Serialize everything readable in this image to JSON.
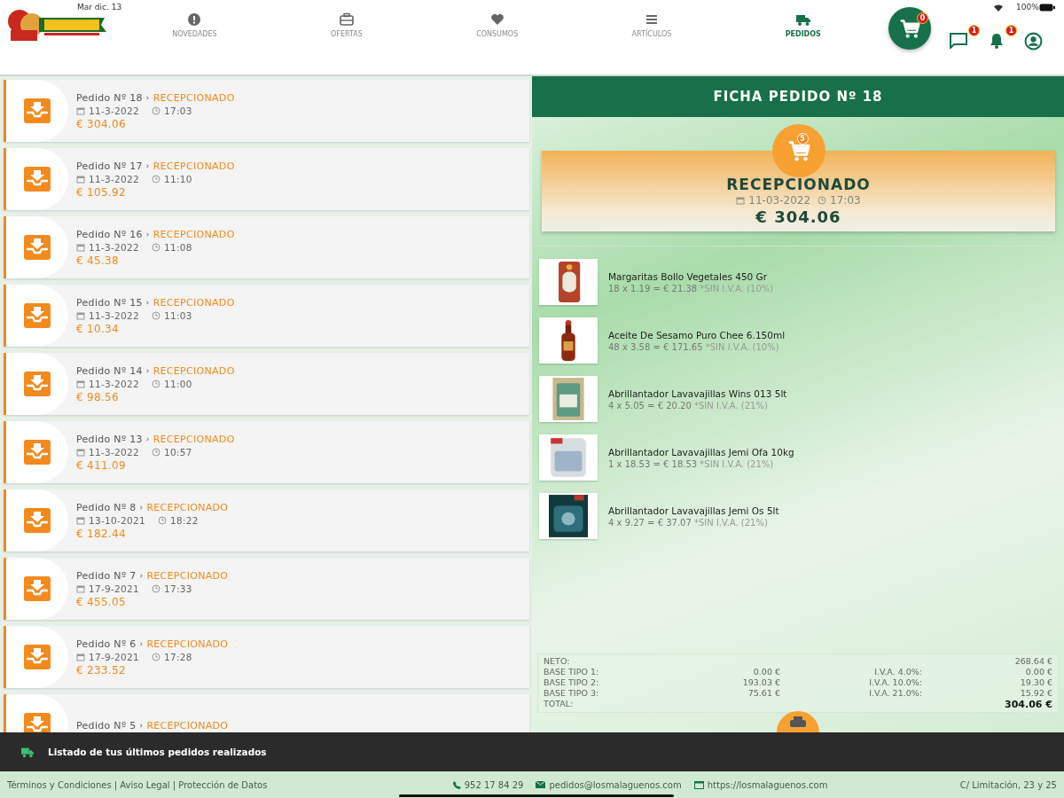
{
  "status_bar": {
    "date": "Mar dic. 13",
    "battery": "100%"
  },
  "nav": [
    {
      "label": "NOVEDADES",
      "selected": false
    },
    {
      "label": "OFERTAS",
      "selected": false
    },
    {
      "label": "CONSUMOS",
      "selected": false
    },
    {
      "label": "ARTÍCULOS",
      "selected": false
    },
    {
      "label": "PEDIDOS",
      "selected": true
    }
  ],
  "cart_badge": "0",
  "messages_badge": "1",
  "alerts_badge": "1",
  "orders": [
    {
      "title": "Pedido Nº 18",
      "sep": "›",
      "status": "RECEPCIONADO",
      "date": "11-3-2022",
      "time": "17:03",
      "amount": "€ 304.06"
    },
    {
      "title": "Pedido Nº 17",
      "sep": "›",
      "status": "RECEPCIONADO",
      "date": "11-3-2022",
      "time": "11:10",
      "amount": "€ 105.92"
    },
    {
      "title": "Pedido Nº 16",
      "sep": "›",
      "status": "RECEPCIONADO",
      "date": "11-3-2022",
      "time": "11:08",
      "amount": "€ 45.38"
    },
    {
      "title": "Pedido Nº 15",
      "sep": "›",
      "status": "RECEPCIONADO",
      "date": "11-3-2022",
      "time": "11:03",
      "amount": "€ 10.34"
    },
    {
      "title": "Pedido Nº 14",
      "sep": "›",
      "status": "RECEPCIONADO",
      "date": "11-3-2022",
      "time": "11:00",
      "amount": "€ 98.56"
    },
    {
      "title": "Pedido Nº 13",
      "sep": "›",
      "status": "RECEPCIONADO",
      "date": "11-3-2022",
      "time": "10:57",
      "amount": "€ 411.09"
    },
    {
      "title": "Pedido Nº 8",
      "sep": "›",
      "status": "RECEPCIONADO",
      "date": "13-10-2021",
      "time": "18:22",
      "amount": "€ 182.44"
    },
    {
      "title": "Pedido Nº 7",
      "sep": "›",
      "status": "RECEPCIONADO",
      "date": "17-9-2021",
      "time": "17:33",
      "amount": "€ 455.05"
    },
    {
      "title": "Pedido Nº 6",
      "sep": "›",
      "status": "RECEPCIONADO",
      "date": "17-9-2021",
      "time": "17:28",
      "amount": "€ 233.52"
    },
    {
      "title": "Pedido Nº 5",
      "sep": "›",
      "status": "RECEPCIONADO"
    }
  ],
  "detail": {
    "title": "FICHA PEDIDO Nº 18",
    "cart_badge": "5",
    "status": "RECEPCIONADO",
    "date": "11-03-2022",
    "time": "17:03",
    "amount": "€ 304.06",
    "items": [
      {
        "name": "Margaritas Bollo Vegetales 450 Gr",
        "line": "18 x 1.19 = € 21.38",
        "tax": "*SIN I.V.A. (10%)"
      },
      {
        "name": "Aceite De Sesamo Puro Chee 6.150ml",
        "line": "48 x 3.58 = € 171.65",
        "tax": "*SIN I.V.A. (10%)"
      },
      {
        "name": "Abrillantador Lavavajillas Wins 013 5lt",
        "line": "4 x 5.05 = € 20.20",
        "tax": "*SIN I.V.A. (21%)"
      },
      {
        "name": "Abrillantador Lavavajillas Jemi Ofa 10kg",
        "line": "1 x 18.53 = € 18.53",
        "tax": "*SIN I.V.A. (21%)"
      },
      {
        "name": "Abrillantador Lavavajillas Jemi Os 5lt",
        "line": "4 x 9.27 = € 37.07",
        "tax": "*SIN I.V.A. (21%)"
      }
    ],
    "totals": [
      {
        "label": "NETO:",
        "value": "268.64 €"
      },
      {
        "label": "BASE TIPO 1:",
        "base": "0.00 €",
        "vat": "I.V.A. 4.0%:",
        "value": "0.00 €"
      },
      {
        "label": "BASE TIPO 2:",
        "base": "193.03 €",
        "vat": "I.V.A. 10.0%:",
        "value": "19.30 €"
      },
      {
        "label": "BASE TIPO 3:",
        "base": "75.61 €",
        "vat": "I.V.A. 21.0%:",
        "value": "15.92 €"
      },
      {
        "label": "TOTAL:",
        "value": "304.06 €",
        "bold": true
      }
    ]
  },
  "snackbar": "Listado de tus últimos pedidos realizados",
  "footer": {
    "legal": "Términos y Condiciones | Aviso Legal | Protección de Datos",
    "phone": "952 17 84 29",
    "email": "pedidos@losmalaguenos.com",
    "web": "https://losmalaguenos.com",
    "address": "C/ Limitación, 23 y 25"
  }
}
